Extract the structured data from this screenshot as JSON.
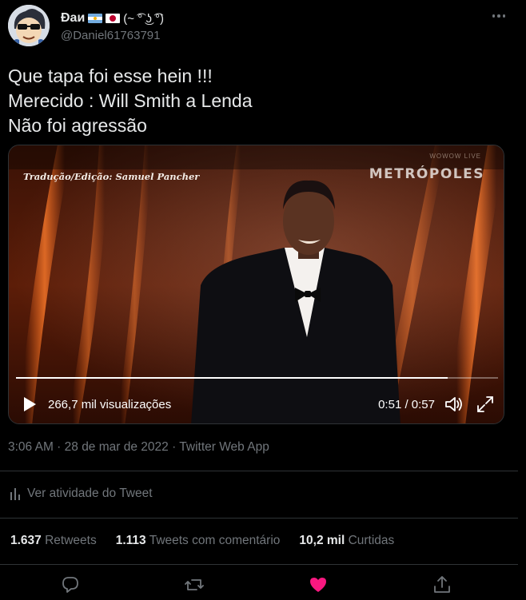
{
  "author": {
    "display_name": "Ðaи",
    "emoticon": "(~ ͡° ͜ʖ ͡°)",
    "handle": "@Daniel61763791",
    "avatar_icon": "sunglasses-cartoon-avatar"
  },
  "tweet": {
    "lines": [
      "Que tapa foi esse hein !!!",
      "Merecido : Will Smith a Lenda",
      "Não foi agressão"
    ]
  },
  "video": {
    "credit": "Tradução/Edição: Samuel Pancher",
    "watermark": "METRÓPOLES",
    "live_tag": "WOWOW LIVE",
    "views": "266,7 mil visualizações",
    "time": "0:51 / 0:57",
    "progress": 0.895
  },
  "meta": {
    "timestamp": "3:06 AM · 28 de mar de 2022 · Twitter Web App"
  },
  "activity": {
    "label": "Ver atividade do Tweet"
  },
  "stats": [
    {
      "value": "1.637",
      "label": "Retweets"
    },
    {
      "value": "1.113",
      "label": "Tweets com comentário"
    },
    {
      "value": "10,2 mil",
      "label": "Curtidas"
    }
  ],
  "colors": {
    "background": "#000000",
    "text": "#e7e9ea",
    "secondary": "#71767b",
    "like": "#f91880",
    "divider": "#2f3336"
  }
}
